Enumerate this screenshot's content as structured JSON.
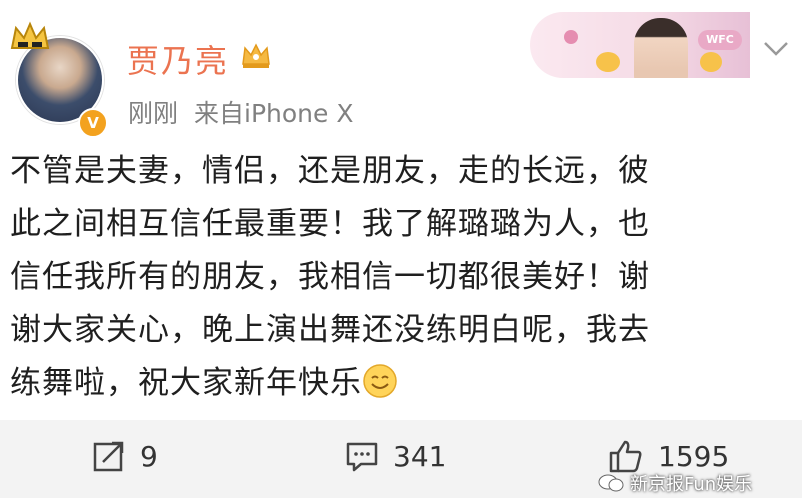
{
  "post": {
    "username": "贾乃亮",
    "verified_badge": "V",
    "time": "刚刚",
    "source": "来自iPhone X",
    "content_lines": [
      "不管是夫妻，情侣，还是朋友，走的长远，彼",
      "此之间相互信任最重要！我了解璐璐为人，也",
      "信任我所有的朋友，我相信一切都很美好！谢",
      "谢大家关心，晚上演出舞还没练明白呢，我去",
      "练舞啦，祝大家新年快乐"
    ],
    "emoji": "smile-emoji"
  },
  "banner": {
    "badge_text": "WFC"
  },
  "actions": {
    "repost_count": "9",
    "comment_count": "341",
    "like_count": "1595"
  },
  "watermark": {
    "text": "新京报Fun娱乐"
  },
  "colors": {
    "username": "#eb7350",
    "meta": "#808080",
    "vip_badge": "#f3a21f",
    "action_bar": "#f3f3f3"
  }
}
